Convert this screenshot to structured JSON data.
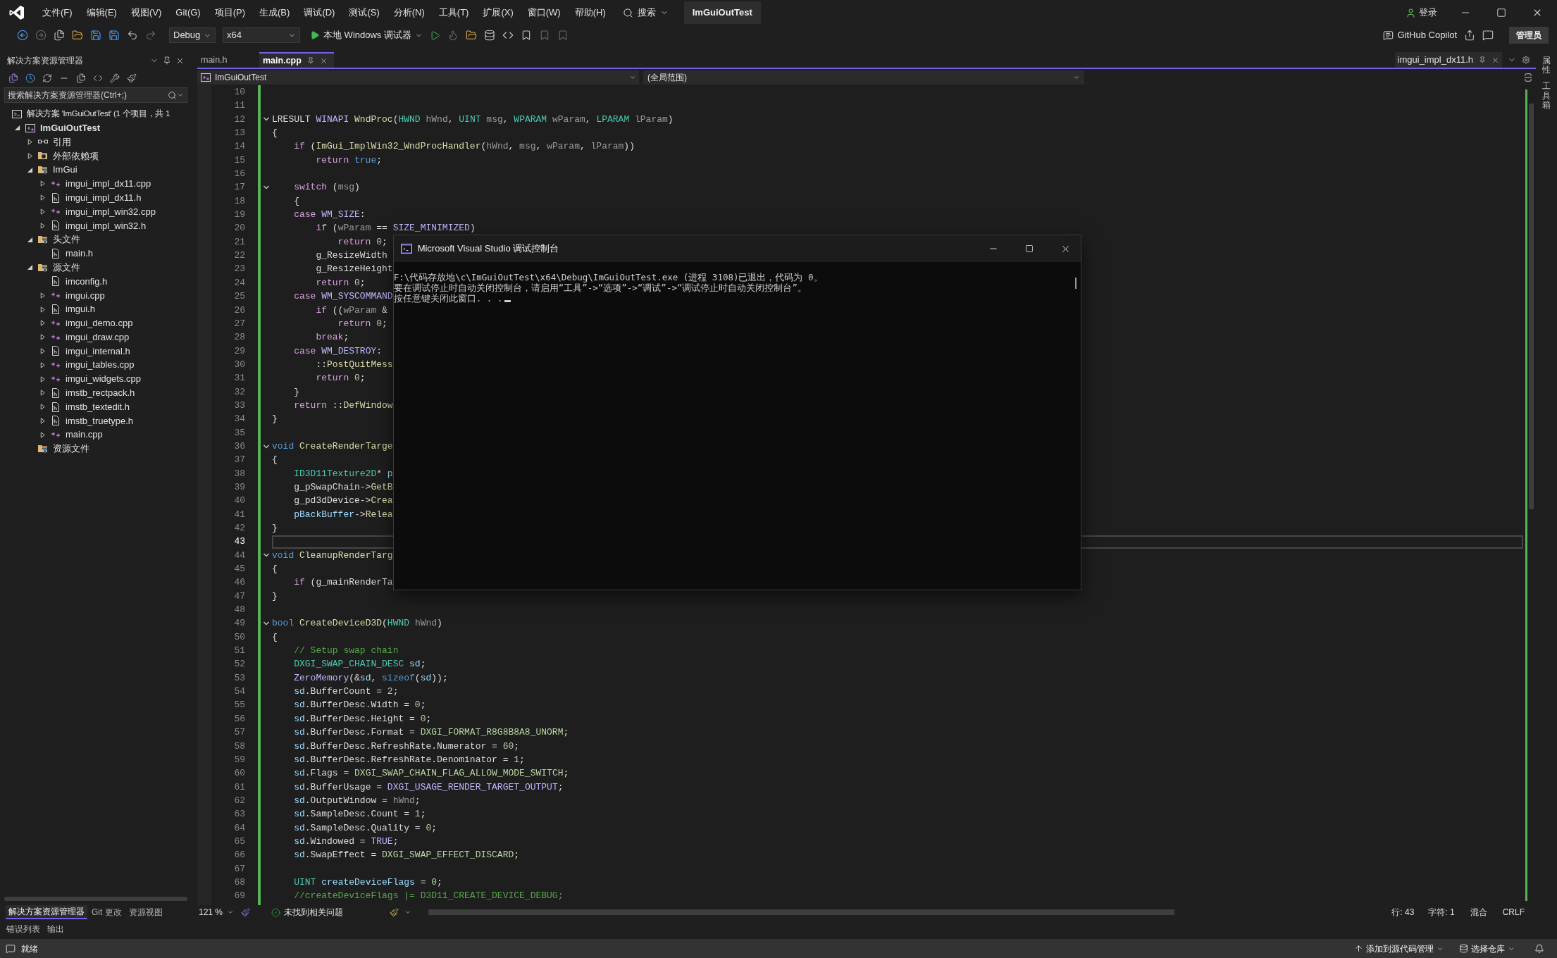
{
  "menu": {
    "items": [
      "文件(F)",
      "编辑(E)",
      "视图(V)",
      "Git(G)",
      "项目(P)",
      "生成(B)",
      "调试(D)",
      "测试(S)",
      "分析(N)",
      "工具(T)",
      "扩展(X)",
      "窗口(W)",
      "帮助(H)"
    ],
    "search": "搜索",
    "solution_name": "ImGuiOutTest",
    "login": "登录"
  },
  "toolbar": {
    "config": "Debug",
    "platform": "x64",
    "run": "本地 Windows 调试器",
    "copilot": "GitHub Copilot",
    "admin": "管理员"
  },
  "solution_explorer": {
    "title": "解决方案资源管理器",
    "search": {
      "placeholder": "搜索解决方案资源管理器(Ctrl+;)"
    },
    "tree": [
      {
        "kind": "solution",
        "label": "解决方案 'ImGuiOutTest' (1 个项目，共 1",
        "children": [
          {
            "kind": "project",
            "label": "ImGuiOutTest",
            "expanded": true,
            "children": [
              {
                "kind": "ref",
                "label": "引用",
                "expanded": false
              },
              {
                "kind": "ext",
                "label": "外部依赖项",
                "expanded": false
              },
              {
                "kind": "filter",
                "label": "ImGui",
                "expanded": true,
                "children": [
                  {
                    "kind": "cpp",
                    "label": "imgui_impl_dx11.cpp",
                    "expanded": false
                  },
                  {
                    "kind": "h",
                    "label": "imgui_impl_dx11.h",
                    "expanded": false
                  },
                  {
                    "kind": "cpp",
                    "label": "imgui_impl_win32.cpp",
                    "expanded": false
                  },
                  {
                    "kind": "h",
                    "label": "imgui_impl_win32.h",
                    "expanded": false
                  }
                ]
              },
              {
                "kind": "filter",
                "label": "头文件",
                "expanded": true,
                "children": [
                  {
                    "kind": "h",
                    "label": "main.h"
                  }
                ]
              },
              {
                "kind": "filter",
                "label": "源文件",
                "expanded": true,
                "children": [
                  {
                    "kind": "h",
                    "label": "imconfig.h"
                  },
                  {
                    "kind": "cpp",
                    "label": "imgui.cpp",
                    "expanded": false
                  },
                  {
                    "kind": "h",
                    "label": "imgui.h",
                    "expanded": false
                  },
                  {
                    "kind": "cpp",
                    "label": "imgui_demo.cpp",
                    "expanded": false
                  },
                  {
                    "kind": "cpp",
                    "label": "imgui_draw.cpp",
                    "expanded": false
                  },
                  {
                    "kind": "h",
                    "label": "imgui_internal.h",
                    "expanded": false
                  },
                  {
                    "kind": "cpp",
                    "label": "imgui_tables.cpp",
                    "expanded": false
                  },
                  {
                    "kind": "cpp",
                    "label": "imgui_widgets.cpp",
                    "expanded": false
                  },
                  {
                    "kind": "h",
                    "label": "imstb_rectpack.h",
                    "expanded": false
                  },
                  {
                    "kind": "h",
                    "label": "imstb_textedit.h",
                    "expanded": false
                  },
                  {
                    "kind": "h",
                    "label": "imstb_truetype.h",
                    "expanded": false
                  },
                  {
                    "kind": "cpp",
                    "label": "main.cpp",
                    "expanded": false
                  }
                ]
              },
              {
                "kind": "filter",
                "label": "资源文件"
              }
            ]
          }
        ]
      }
    ],
    "bottom_tabs": [
      {
        "label": "解决方案资源管理器",
        "selected": true
      },
      {
        "label": "Git 更改",
        "selected": false
      },
      {
        "label": "资源视图",
        "selected": false
      }
    ]
  },
  "editor": {
    "tabs": [
      {
        "label": "main.h",
        "selected": false
      },
      {
        "label": "main.cpp",
        "selected": true
      }
    ],
    "preview_tab": "imgui_impl_dx11.h",
    "project_scope": "ImGuiOutTest",
    "member_scope": "(全局范围)",
    "lines": [
      {
        "n": "10",
        "current": false
      },
      {
        "n": "11",
        "current": false
      },
      {
        "n": "12",
        "current": false,
        "expanded": true,
        "tokens": [
          {
            "kind": "plain",
            "text": "LRESULT "
          },
          {
            "kind": "macro",
            "text": "WINAPI"
          },
          {
            "kind": "function",
            "text": " WndProc"
          },
          {
            "kind": "plain",
            "text": "("
          },
          {
            "kind": "type",
            "text": "HWND"
          },
          {
            "kind": "param",
            "text": " hWnd"
          },
          {
            "kind": "plain",
            "text": ", "
          },
          {
            "kind": "type",
            "text": "UINT"
          },
          {
            "kind": "param",
            "text": " msg"
          },
          {
            "kind": "plain",
            "text": ", "
          },
          {
            "kind": "type",
            "text": "WPARAM"
          },
          {
            "kind": "param",
            "text": " wParam"
          },
          {
            "kind": "plain",
            "text": ", "
          },
          {
            "kind": "type",
            "text": "LPARAM"
          },
          {
            "kind": "param",
            "text": " lParam"
          },
          {
            "kind": "plain",
            "text": ")"
          }
        ]
      },
      {
        "n": "13",
        "current": false,
        "tokens": [
          {
            "kind": "plain",
            "text": "{"
          }
        ]
      },
      {
        "n": "14",
        "current": false,
        "tokens": [
          {
            "kind": "control",
            "text": "    if"
          },
          {
            "kind": "plain",
            "text": " ("
          },
          {
            "kind": "function",
            "text": "ImGui_ImplWin32_WndProcHandler"
          },
          {
            "kind": "plain",
            "text": "("
          },
          {
            "kind": "param",
            "text": "hWnd"
          },
          {
            "kind": "plain",
            "text": ", "
          },
          {
            "kind": "param",
            "text": "msg"
          },
          {
            "kind": "plain",
            "text": ", "
          },
          {
            "kind": "param",
            "text": "wParam"
          },
          {
            "kind": "plain",
            "text": ", "
          },
          {
            "kind": "param",
            "text": "lParam"
          },
          {
            "kind": "plain",
            "text": "))"
          }
        ]
      },
      {
        "n": "15",
        "current": false,
        "tokens": [
          {
            "kind": "control",
            "text": "        return"
          },
          {
            "kind": "keyword",
            "text": " true"
          },
          {
            "kind": "plain",
            "text": ";"
          }
        ]
      },
      {
        "n": "16",
        "current": false
      },
      {
        "n": "17",
        "current": false,
        "expanded": true,
        "tokens": [
          {
            "kind": "control",
            "text": "    switch"
          },
          {
            "kind": "plain",
            "text": " ("
          },
          {
            "kind": "param",
            "text": "msg"
          },
          {
            "kind": "plain",
            "text": ")"
          }
        ]
      },
      {
        "n": "18",
        "current": false,
        "tokens": [
          {
            "kind": "plain",
            "text": "    {"
          }
        ]
      },
      {
        "n": "19",
        "current": false,
        "tokens": [
          {
            "kind": "control",
            "text": "    case"
          },
          {
            "kind": "macro",
            "text": " WM_SIZE"
          },
          {
            "kind": "plain",
            "text": ":"
          }
        ]
      },
      {
        "n": "20",
        "current": false,
        "tokens": [
          {
            "kind": "control",
            "text": "        if"
          },
          {
            "kind": "plain",
            "text": " ("
          },
          {
            "kind": "param",
            "text": "wParam"
          },
          {
            "kind": "plain",
            "text": " == "
          },
          {
            "kind": "macro",
            "text": "SIZE_MINIMIZED"
          },
          {
            "kind": "plain",
            "text": ")"
          }
        ]
      },
      {
        "n": "21",
        "current": false,
        "tokens": [
          {
            "kind": "control",
            "text": "            return"
          },
          {
            "kind": "number",
            "text": " 0"
          },
          {
            "kind": "plain",
            "text": ";"
          }
        ]
      },
      {
        "n": "22",
        "current": false,
        "tokens": [
          {
            "kind": "plain",
            "text": "        g_ResizeWidth"
          }
        ]
      },
      {
        "n": "23",
        "current": false,
        "tokens": [
          {
            "kind": "plain",
            "text": "        g_ResizeHeight"
          }
        ]
      },
      {
        "n": "24",
        "current": false,
        "tokens": [
          {
            "kind": "control",
            "text": "        return"
          },
          {
            "kind": "number",
            "text": " 0"
          },
          {
            "kind": "plain",
            "text": ";"
          }
        ]
      },
      {
        "n": "25",
        "current": false,
        "tokens": [
          {
            "kind": "control",
            "text": "    case"
          },
          {
            "kind": "macro",
            "text": " WM_SYSCOMMAND"
          }
        ]
      },
      {
        "n": "26",
        "current": false,
        "tokens": [
          {
            "kind": "control",
            "text": "        if"
          },
          {
            "kind": "plain",
            "text": " (("
          },
          {
            "kind": "param",
            "text": "wParam"
          },
          {
            "kind": "plain",
            "text": " &"
          }
        ]
      },
      {
        "n": "27",
        "current": false,
        "tokens": [
          {
            "kind": "control",
            "text": "            return"
          },
          {
            "kind": "number",
            "text": " 0"
          },
          {
            "kind": "plain",
            "text": ";"
          }
        ]
      },
      {
        "n": "28",
        "current": false,
        "tokens": [
          {
            "kind": "control",
            "text": "        break"
          },
          {
            "kind": "plain",
            "text": ";"
          }
        ]
      },
      {
        "n": "29",
        "current": false,
        "tokens": [
          {
            "kind": "control",
            "text": "    case"
          },
          {
            "kind": "macro",
            "text": " WM_DESTROY"
          },
          {
            "kind": "plain",
            "text": ":"
          }
        ]
      },
      {
        "n": "30",
        "current": false,
        "tokens": [
          {
            "kind": "plain",
            "text": "        ::"
          },
          {
            "kind": "function",
            "text": "PostQuitMess"
          }
        ]
      },
      {
        "n": "31",
        "current": false,
        "tokens": [
          {
            "kind": "control",
            "text": "        return"
          },
          {
            "kind": "number",
            "text": " 0"
          },
          {
            "kind": "plain",
            "text": ";"
          }
        ]
      },
      {
        "n": "32",
        "current": false,
        "tokens": [
          {
            "kind": "plain",
            "text": "    }"
          }
        ]
      },
      {
        "n": "33",
        "current": false,
        "tokens": [
          {
            "kind": "control",
            "text": "    return"
          },
          {
            "kind": "plain",
            "text": " ::"
          },
          {
            "kind": "function",
            "text": "DefWindow"
          }
        ]
      },
      {
        "n": "34",
        "current": false,
        "tokens": [
          {
            "kind": "plain",
            "text": "}"
          }
        ]
      },
      {
        "n": "35",
        "current": false
      },
      {
        "n": "36",
        "current": false,
        "expanded": true,
        "tokens": [
          {
            "kind": "keyword",
            "text": "void"
          },
          {
            "kind": "function",
            "text": " CreateRenderTarge"
          }
        ]
      },
      {
        "n": "37",
        "current": false,
        "tokens": [
          {
            "kind": "plain",
            "text": "{"
          }
        ]
      },
      {
        "n": "38",
        "current": false,
        "tokens": [
          {
            "kind": "type",
            "text": "    ID3D11Texture2D"
          },
          {
            "kind": "plain",
            "text": "* "
          },
          {
            "kind": "local",
            "text": "p"
          }
        ]
      },
      {
        "n": "39",
        "current": false,
        "tokens": [
          {
            "kind": "plain",
            "text": "    g_pSwapChain->"
          },
          {
            "kind": "function",
            "text": "GetB"
          }
        ]
      },
      {
        "n": "40",
        "current": false,
        "tokens": [
          {
            "kind": "plain",
            "text": "    g_pd3dDevice->"
          },
          {
            "kind": "function",
            "text": "Crea"
          }
        ]
      },
      {
        "n": "41",
        "current": false,
        "tokens": [
          {
            "kind": "local",
            "text": "    pBackBuffer"
          },
          {
            "kind": "plain",
            "text": "->"
          },
          {
            "kind": "function",
            "text": "Relea"
          }
        ]
      },
      {
        "n": "42",
        "current": false,
        "tokens": [
          {
            "kind": "plain",
            "text": "}"
          }
        ]
      },
      {
        "n": "43",
        "current": true
      },
      {
        "n": "44",
        "current": false,
        "expanded": true,
        "tokens": [
          {
            "kind": "keyword",
            "text": "void"
          },
          {
            "kind": "function",
            "text": " CleanupRenderTarg"
          }
        ]
      },
      {
        "n": "45",
        "current": false,
        "tokens": [
          {
            "kind": "plain",
            "text": "{"
          }
        ]
      },
      {
        "n": "46",
        "current": false,
        "tokens": [
          {
            "kind": "control",
            "text": "    if"
          },
          {
            "kind": "plain",
            "text": " (g_mainRenderTa"
          }
        ]
      },
      {
        "n": "47",
        "current": false,
        "tokens": [
          {
            "kind": "plain",
            "text": "}"
          }
        ]
      },
      {
        "n": "48",
        "current": false
      },
      {
        "n": "49",
        "current": false,
        "expanded": true,
        "tokens": [
          {
            "kind": "keyword",
            "text": "bool"
          },
          {
            "kind": "function",
            "text": " CreateDeviceD3D"
          },
          {
            "kind": "plain",
            "text": "("
          },
          {
            "kind": "type",
            "text": "HWND"
          },
          {
            "kind": "param",
            "text": " hWnd"
          },
          {
            "kind": "plain",
            "text": ")"
          }
        ]
      },
      {
        "n": "50",
        "current": false,
        "tokens": [
          {
            "kind": "plain",
            "text": "{"
          }
        ]
      },
      {
        "n": "51",
        "current": false,
        "tokens": [
          {
            "kind": "comment",
            "text": "    // Setup swap chain"
          }
        ]
      },
      {
        "n": "52",
        "current": false,
        "tokens": [
          {
            "kind": "type",
            "text": "    DXGI_SWAP_CHAIN_DESC"
          },
          {
            "kind": "local",
            "text": " sd"
          },
          {
            "kind": "plain",
            "text": ";"
          }
        ]
      },
      {
        "n": "53",
        "current": false,
        "tokens": [
          {
            "kind": "macro",
            "text": "    ZeroMemory"
          },
          {
            "kind": "plain",
            "text": "(&"
          },
          {
            "kind": "local",
            "text": "sd"
          },
          {
            "kind": "plain",
            "text": ", "
          },
          {
            "kind": "keyword",
            "text": "sizeof"
          },
          {
            "kind": "plain",
            "text": "("
          },
          {
            "kind": "local",
            "text": "sd"
          },
          {
            "kind": "plain",
            "text": "));"
          }
        ]
      },
      {
        "n": "54",
        "current": false,
        "tokens": [
          {
            "kind": "local",
            "text": "    sd"
          },
          {
            "kind": "plain",
            "text": ".BufferCount = "
          },
          {
            "kind": "number",
            "text": "2"
          },
          {
            "kind": "plain",
            "text": ";"
          }
        ]
      },
      {
        "n": "55",
        "current": false,
        "tokens": [
          {
            "kind": "local",
            "text": "    sd"
          },
          {
            "kind": "plain",
            "text": ".BufferDesc.Width = "
          },
          {
            "kind": "number",
            "text": "0"
          },
          {
            "kind": "plain",
            "text": ";"
          }
        ]
      },
      {
        "n": "56",
        "current": false,
        "tokens": [
          {
            "kind": "local",
            "text": "    sd"
          },
          {
            "kind": "plain",
            "text": ".BufferDesc.Height = "
          },
          {
            "kind": "number",
            "text": "0"
          },
          {
            "kind": "plain",
            "text": ";"
          }
        ]
      },
      {
        "n": "57",
        "current": false,
        "tokens": [
          {
            "kind": "local",
            "text": "    sd"
          },
          {
            "kind": "plain",
            "text": ".BufferDesc.Format = "
          },
          {
            "kind": "enum",
            "text": "DXGI_FORMAT_R8G8B8A8_UNORM"
          },
          {
            "kind": "plain",
            "text": ";"
          }
        ]
      },
      {
        "n": "58",
        "current": false,
        "tokens": [
          {
            "kind": "local",
            "text": "    sd"
          },
          {
            "kind": "plain",
            "text": ".BufferDesc.RefreshRate.Numerator = "
          },
          {
            "kind": "number",
            "text": "60"
          },
          {
            "kind": "plain",
            "text": ";"
          }
        ]
      },
      {
        "n": "59",
        "current": false,
        "tokens": [
          {
            "kind": "local",
            "text": "    sd"
          },
          {
            "kind": "plain",
            "text": ".BufferDesc.RefreshRate.Denominator = "
          },
          {
            "kind": "number",
            "text": "1"
          },
          {
            "kind": "plain",
            "text": ";"
          }
        ]
      },
      {
        "n": "60",
        "current": false,
        "tokens": [
          {
            "kind": "local",
            "text": "    sd"
          },
          {
            "kind": "plain",
            "text": ".Flags = "
          },
          {
            "kind": "enum",
            "text": "DXGI_SWAP_CHAIN_FLAG_ALLOW_MODE_SWITCH"
          },
          {
            "kind": "plain",
            "text": ";"
          }
        ]
      },
      {
        "n": "61",
        "current": false,
        "tokens": [
          {
            "kind": "local",
            "text": "    sd"
          },
          {
            "kind": "plain",
            "text": ".BufferUsage = "
          },
          {
            "kind": "macro",
            "text": "DXGI_USAGE_RENDER_TARGET_OUTPUT"
          },
          {
            "kind": "plain",
            "text": ";"
          }
        ]
      },
      {
        "n": "62",
        "current": false,
        "tokens": [
          {
            "kind": "local",
            "text": "    sd"
          },
          {
            "kind": "plain",
            "text": ".OutputWindow = "
          },
          {
            "kind": "param",
            "text": "hWnd"
          },
          {
            "kind": "plain",
            "text": ";"
          }
        ]
      },
      {
        "n": "63",
        "current": false,
        "tokens": [
          {
            "kind": "local",
            "text": "    sd"
          },
          {
            "kind": "plain",
            "text": ".SampleDesc.Count = "
          },
          {
            "kind": "number",
            "text": "1"
          },
          {
            "kind": "plain",
            "text": ";"
          }
        ]
      },
      {
        "n": "64",
        "current": false,
        "tokens": [
          {
            "kind": "local",
            "text": "    sd"
          },
          {
            "kind": "plain",
            "text": ".SampleDesc.Quality = "
          },
          {
            "kind": "number",
            "text": "0"
          },
          {
            "kind": "plain",
            "text": ";"
          }
        ]
      },
      {
        "n": "65",
        "current": false,
        "tokens": [
          {
            "kind": "local",
            "text": "    sd"
          },
          {
            "kind": "plain",
            "text": ".Windowed = "
          },
          {
            "kind": "macro",
            "text": "TRUE"
          },
          {
            "kind": "plain",
            "text": ";"
          }
        ]
      },
      {
        "n": "66",
        "current": false,
        "tokens": [
          {
            "kind": "local",
            "text": "    sd"
          },
          {
            "kind": "plain",
            "text": ".SwapEffect = "
          },
          {
            "kind": "enum",
            "text": "DXGI_SWAP_EFFECT_DISCARD"
          },
          {
            "kind": "plain",
            "text": ";"
          }
        ]
      },
      {
        "n": "67",
        "current": false
      },
      {
        "n": "68",
        "current": false,
        "tokens": [
          {
            "kind": "type",
            "text": "    UINT"
          },
          {
            "kind": "local",
            "text": " createDeviceFlags"
          },
          {
            "kind": "plain",
            "text": " = "
          },
          {
            "kind": "number",
            "text": "0"
          },
          {
            "kind": "plain",
            "text": ";"
          }
        ]
      },
      {
        "n": "69",
        "current": false,
        "tokens": [
          {
            "kind": "comment",
            "text": "    //createDeviceFlags |= D3D11_CREATE_DEVICE_DEBUG;"
          }
        ]
      }
    ],
    "status": {
      "zoom": "121 %",
      "issues": "未找到相关问题",
      "line": "行: 43",
      "char": "字符: 1",
      "indent": "混合",
      "eol": "CRLF"
    }
  },
  "console": {
    "title": "Microsoft Visual Studio 调试控制台",
    "lines": [
      "F:\\代码存放地\\c\\ImGuiOutTest\\x64\\Debug\\ImGuiOutTest.exe (进程 3108)已退出，代码为 0。",
      "要在调试停止时自动关闭控制台，请启用“工具”->“选项”->“调试”->“调试停止时自动关闭控制台”。",
      "按任意键关闭此窗口. . ."
    ]
  },
  "side_tabs": [
    "属性",
    "工具箱"
  ],
  "bottom_panel_tabs": [
    {
      "label": "错误列表",
      "selected": false
    },
    {
      "label": "输出",
      "selected": false
    }
  ],
  "status_bar": {
    "status": "就绪",
    "source_control": "添加到源代码管理",
    "repo": "选择仓库"
  }
}
